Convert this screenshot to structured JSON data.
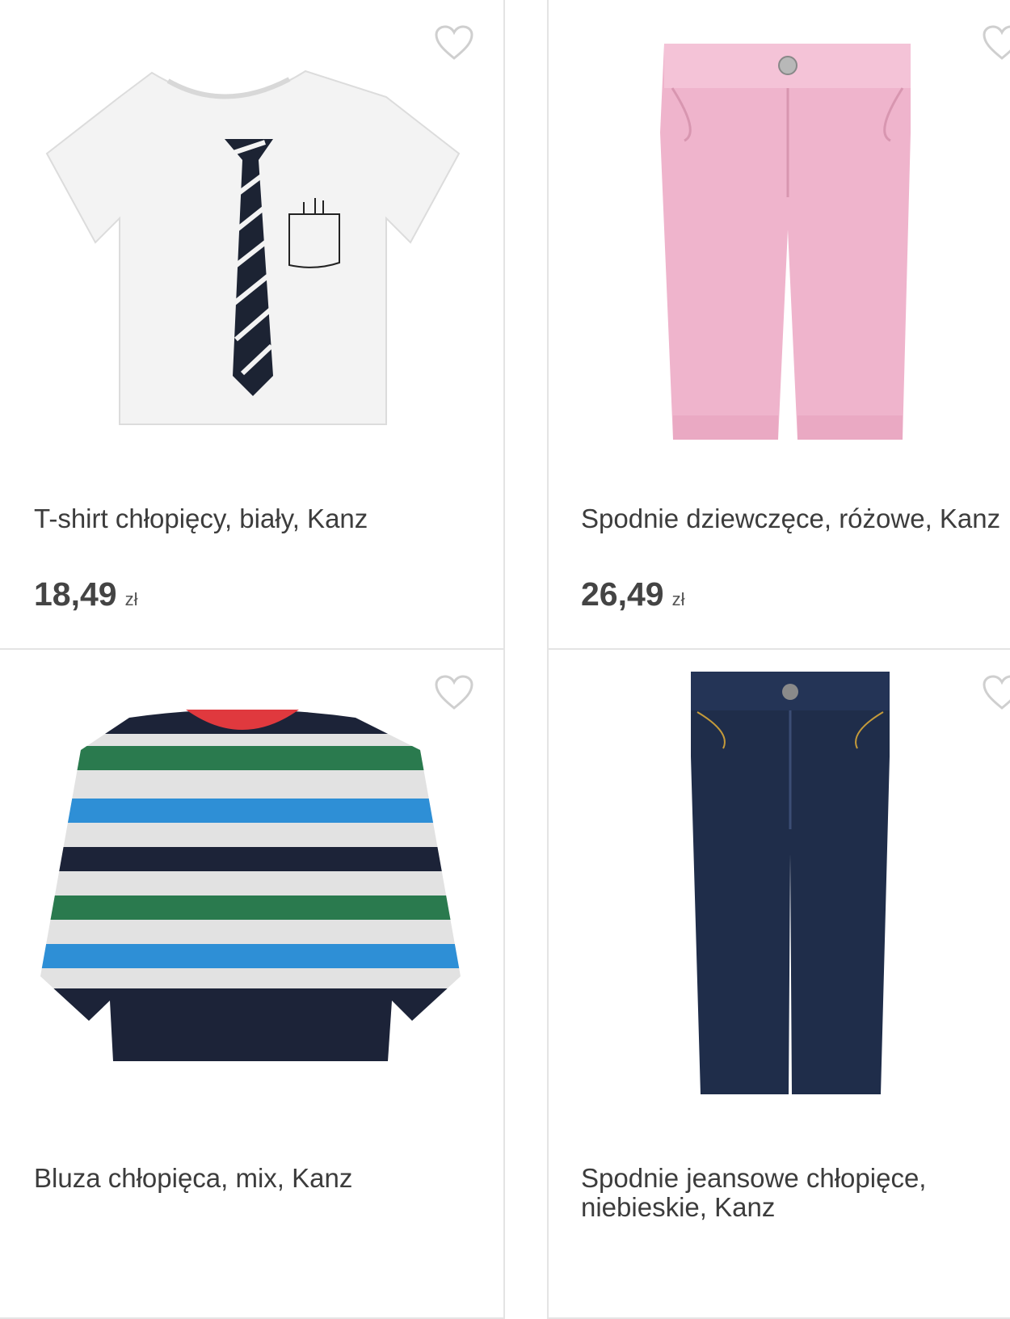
{
  "products": [
    {
      "title": "T-shirt chłopięcy, biały, Kanz",
      "price": "18,49",
      "currency": "zł"
    },
    {
      "title": "Spodnie dziewczęce, różowe, Kanz",
      "price": "26,49",
      "currency": "zł"
    },
    {
      "title": "Bluza chłopięca, mix, Kanz",
      "price": "",
      "currency": ""
    },
    {
      "title": "Spodnie jeansowe chłopięce,\nniebieskie, Kanz",
      "price": "",
      "currency": ""
    }
  ],
  "icons": {
    "favorite": "heart-outline-icon"
  }
}
